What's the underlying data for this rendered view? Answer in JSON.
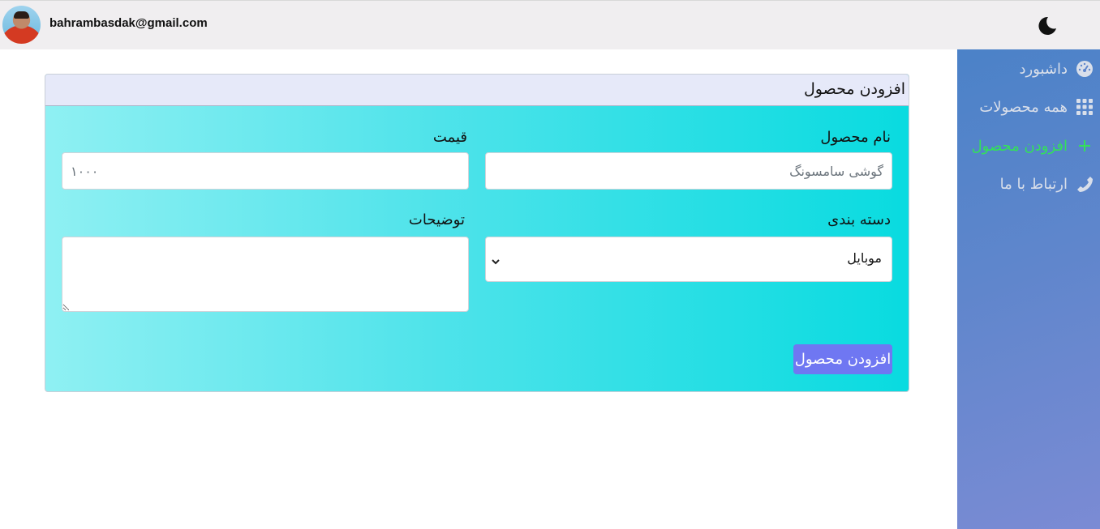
{
  "header": {
    "email": "bahrambasdak@gmail.com"
  },
  "sidebar": {
    "items": [
      {
        "label": "داشبورد",
        "icon": "dashboard-gauge-icon",
        "active": false
      },
      {
        "label": "همه محصولات",
        "icon": "grid-icon",
        "active": false
      },
      {
        "label": "افزودن محصول",
        "icon": "plus-icon",
        "active": true
      },
      {
        "label": "ارتباط با ما",
        "icon": "phone-icon",
        "active": false
      }
    ]
  },
  "form": {
    "title": "افزودن محصول",
    "product_name_label": "نام محصول",
    "product_name_placeholder": "گوشی سامسونگ",
    "price_label": "قیمت",
    "price_placeholder": "۱۰۰۰",
    "category_label": "دسته بندی",
    "category_selected": "موبایل",
    "description_label": "توضیحات",
    "submit_label": "افزودن محصول"
  },
  "colors": {
    "sidebar_active": "#33e05a",
    "button_bg": "#6f77f2",
    "card_gradient_start": "#8ff0f3",
    "card_gradient_end": "#09dbe0"
  }
}
